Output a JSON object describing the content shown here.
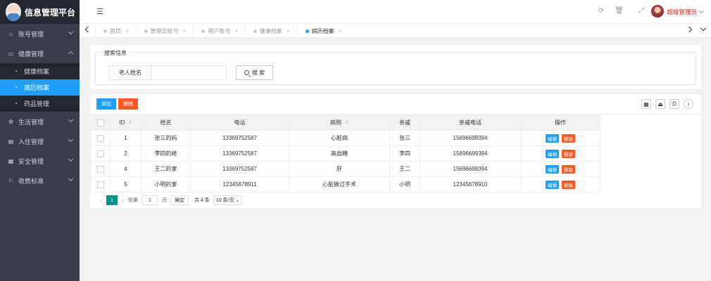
{
  "app": {
    "title": "信息管理平台"
  },
  "sidebar": {
    "items": [
      {
        "label": "账号管理",
        "icon": "home-icon"
      },
      {
        "label": "健康管理",
        "icon": "box-icon",
        "expanded": true,
        "children": [
          {
            "label": "健康档案",
            "icon": "dashboard-icon"
          },
          {
            "label": "病历档案",
            "icon": "dashboard-icon",
            "active": true
          },
          {
            "label": "药品管理",
            "icon": "dashboard-icon"
          }
        ]
      },
      {
        "label": "生活管理",
        "icon": "cogs-icon"
      },
      {
        "label": "入住管理",
        "icon": "file-icon"
      },
      {
        "label": "安全管理",
        "icon": "calendar-icon"
      },
      {
        "label": "收费标准",
        "icon": "flag-icon"
      }
    ]
  },
  "header": {
    "user": "超级管理员"
  },
  "tabs": [
    {
      "label": "首页"
    },
    {
      "label": "管理员账号"
    },
    {
      "label": "用户账号"
    },
    {
      "label": "健康档案"
    },
    {
      "label": "病历档案",
      "active": true
    }
  ],
  "search": {
    "legend": "搜索信息",
    "field_label": "老人姓名",
    "value": "",
    "button": "搜 索"
  },
  "toolbar": {
    "add": "添加",
    "delete": "删除"
  },
  "table": {
    "headers": [
      "ID",
      "姓名",
      "电话",
      "病例",
      "亲戚",
      "亲戚电话",
      "操作"
    ],
    "edit_label": "编辑",
    "delete_label": "删除",
    "rows": [
      {
        "id": "1",
        "name": "张三的妈",
        "phone": "13369752587",
        "case": "心脏病",
        "relative": "张三",
        "rel_phone": "15696699394"
      },
      {
        "id": "2",
        "name": "李四的姥",
        "phone": "13369752587",
        "case": "高血糖",
        "relative": "李四",
        "rel_phone": "15696699394"
      },
      {
        "id": "4",
        "name": "王二的爹",
        "phone": "13369752587",
        "case": "肝",
        "relative": "王二",
        "rel_phone": "15696699394"
      },
      {
        "id": "5",
        "name": "小明的爹",
        "phone": "12345678911",
        "case": "心脏做过手术",
        "relative": "小明",
        "rel_phone": "12345678910"
      }
    ]
  },
  "pager": {
    "current": "1",
    "goto_label": "到第",
    "goto_value": "1",
    "page_unit": "页",
    "confirm": "确定",
    "total": "共 4 条",
    "limit": "10 条/页"
  },
  "colors": {
    "accent": "#1e9fff",
    "danger": "#ff5722",
    "sidebar": "#393d49",
    "pager_active": "#009688"
  }
}
